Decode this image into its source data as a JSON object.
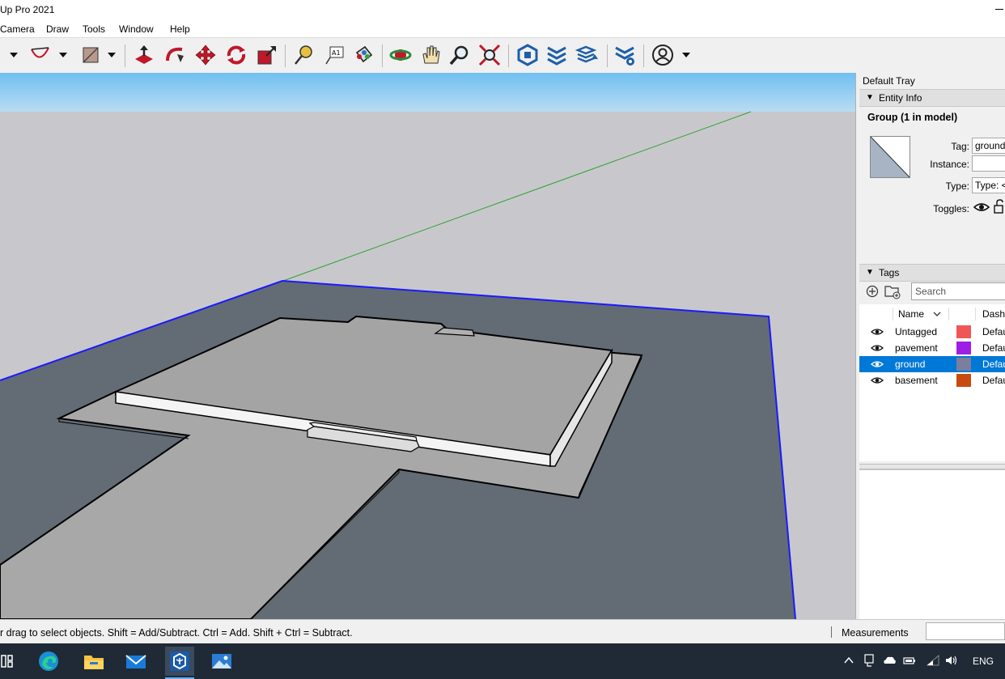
{
  "window": {
    "title": "Up Pro 2021"
  },
  "menu": [
    "Camera",
    "Draw",
    "Tools",
    "Window",
    "Help"
  ],
  "toolbar": {
    "icons": [
      "pencil-dropdown-icon",
      "arc-icon",
      "shapes-icon",
      "push-pull-icon",
      "follow-me-icon",
      "move-icon",
      "rotate-icon",
      "scale-icon",
      "tape-measure-icon",
      "text-icon",
      "paint-bucket-icon",
      "orbit-icon",
      "pan-icon",
      "zoom-icon",
      "zoom-extents-icon",
      "3d-warehouse-icon",
      "extension-warehouse-icon",
      "layout-icon",
      "extension-manager-icon",
      "account-icon"
    ]
  },
  "status": {
    "hint": "r drag to select objects. Shift = Add/Subtract. Ctrl = Add. Shift + Ctrl = Subtract.",
    "measurements_label": "Measurements",
    "measurements_value": ""
  },
  "tray": {
    "title": "Default Tray",
    "entity_info": {
      "section_label": "Entity Info",
      "selection_title": "Group (1 in model)",
      "tag_label": "Tag:",
      "tag_value": "ground",
      "instance_label": "Instance:",
      "instance_value": "",
      "type_label": "Type:",
      "type_value": "Type: <",
      "toggles_label": "Toggles:"
    },
    "tags": {
      "section_label": "Tags",
      "search_placeholder": "Search",
      "col_name": "Name",
      "col_dash": "Dash",
      "rows": [
        {
          "name": "Untagged",
          "color": "#ef5656",
          "dash": "Defau",
          "selected": false
        },
        {
          "name": "pavement",
          "color": "#9e1ee6",
          "dash": "Defau",
          "selected": false
        },
        {
          "name": "ground",
          "color": "#7b7f9e",
          "dash": "Defau",
          "selected": true
        },
        {
          "name": "basement",
          "color": "#c84a10",
          "dash": "Defau",
          "selected": false
        }
      ]
    }
  },
  "taskbar": {
    "apps": [
      "task-view-icon",
      "edge-icon",
      "file-explorer-icon",
      "mail-icon",
      "sketchup-icon",
      "photos-icon"
    ],
    "language": "ENG"
  },
  "colors": {
    "sky": "#c8c8cc",
    "ground_plane": "#636b75",
    "model_face": "#a6a6a6",
    "selection_blue": "#0000ff",
    "green_axis": "#2ea32e",
    "tag_selected": "#0078d7"
  }
}
